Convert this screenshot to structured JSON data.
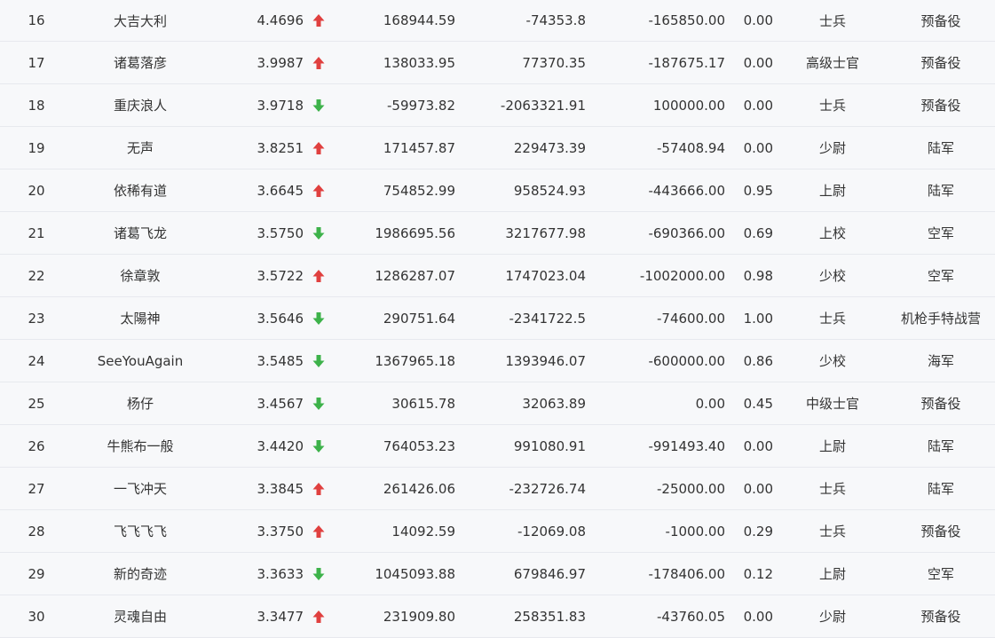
{
  "colors": {
    "up": "#e0403f",
    "down": "#3db24a",
    "text": "#333333",
    "divider": "#e7e9ee",
    "background": "#f7f8fa"
  },
  "rows": [
    {
      "rank": "16",
      "name": "大吉大利",
      "score": "4.4696",
      "trend": "up",
      "v1": "168944.59",
      "v2": "-74353.8",
      "v3": "-165850.00",
      "ratio": "0.00",
      "military_rank": "士兵",
      "branch": "预备役"
    },
    {
      "rank": "17",
      "name": "诸葛落彦",
      "score": "3.9987",
      "trend": "up",
      "v1": "138033.95",
      "v2": "77370.35",
      "v3": "-187675.17",
      "ratio": "0.00",
      "military_rank": "高级士官",
      "branch": "预备役"
    },
    {
      "rank": "18",
      "name": "重庆浪人",
      "score": "3.9718",
      "trend": "down",
      "v1": "-59973.82",
      "v2": "-2063321.91",
      "v3": "100000.00",
      "ratio": "0.00",
      "military_rank": "士兵",
      "branch": "预备役"
    },
    {
      "rank": "19",
      "name": "无声",
      "score": "3.8251",
      "trend": "up",
      "v1": "171457.87",
      "v2": "229473.39",
      "v3": "-57408.94",
      "ratio": "0.00",
      "military_rank": "少尉",
      "branch": "陆军"
    },
    {
      "rank": "20",
      "name": "依稀有道",
      "score": "3.6645",
      "trend": "up",
      "v1": "754852.99",
      "v2": "958524.93",
      "v3": "-443666.00",
      "ratio": "0.95",
      "military_rank": "上尉",
      "branch": "陆军"
    },
    {
      "rank": "21",
      "name": "诸葛飞龙",
      "score": "3.5750",
      "trend": "down",
      "v1": "1986695.56",
      "v2": "3217677.98",
      "v3": "-690366.00",
      "ratio": "0.69",
      "military_rank": "上校",
      "branch": "空军"
    },
    {
      "rank": "22",
      "name": "徐章敦",
      "score": "3.5722",
      "trend": "up",
      "v1": "1286287.07",
      "v2": "1747023.04",
      "v3": "-1002000.00",
      "ratio": "0.98",
      "military_rank": "少校",
      "branch": "空军"
    },
    {
      "rank": "23",
      "name": "太陽神",
      "score": "3.5646",
      "trend": "down",
      "v1": "290751.64",
      "v2": "-2341722.5",
      "v3": "-74600.00",
      "ratio": "1.00",
      "military_rank": "士兵",
      "branch": "机枪手特战营"
    },
    {
      "rank": "24",
      "name": "SeeYouAgain",
      "score": "3.5485",
      "trend": "down",
      "v1": "1367965.18",
      "v2": "1393946.07",
      "v3": "-600000.00",
      "ratio": "0.86",
      "military_rank": "少校",
      "branch": "海军"
    },
    {
      "rank": "25",
      "name": "杨仔",
      "score": "3.4567",
      "trend": "down",
      "v1": "30615.78",
      "v2": "32063.89",
      "v3": "0.00",
      "ratio": "0.45",
      "military_rank": "中级士官",
      "branch": "预备役"
    },
    {
      "rank": "26",
      "name": "牛熊布一般",
      "score": "3.4420",
      "trend": "down",
      "v1": "764053.23",
      "v2": "991080.91",
      "v3": "-991493.40",
      "ratio": "0.00",
      "military_rank": "上尉",
      "branch": "陆军"
    },
    {
      "rank": "27",
      "name": "一飞冲天",
      "score": "3.3845",
      "trend": "up",
      "v1": "261426.06",
      "v2": "-232726.74",
      "v3": "-25000.00",
      "ratio": "0.00",
      "military_rank": "士兵",
      "branch": "陆军"
    },
    {
      "rank": "28",
      "name": "飞飞飞飞",
      "score": "3.3750",
      "trend": "up",
      "v1": "14092.59",
      "v2": "-12069.08",
      "v3": "-1000.00",
      "ratio": "0.29",
      "military_rank": "士兵",
      "branch": "预备役"
    },
    {
      "rank": "29",
      "name": "新的奇迹",
      "score": "3.3633",
      "trend": "down",
      "v1": "1045093.88",
      "v2": "679846.97",
      "v3": "-178406.00",
      "ratio": "0.12",
      "military_rank": "上尉",
      "branch": "空军"
    },
    {
      "rank": "30",
      "name": "灵魂自由",
      "score": "3.3477",
      "trend": "up",
      "v1": "231909.80",
      "v2": "258351.83",
      "v3": "-43760.05",
      "ratio": "0.00",
      "military_rank": "少尉",
      "branch": "预备役"
    }
  ]
}
